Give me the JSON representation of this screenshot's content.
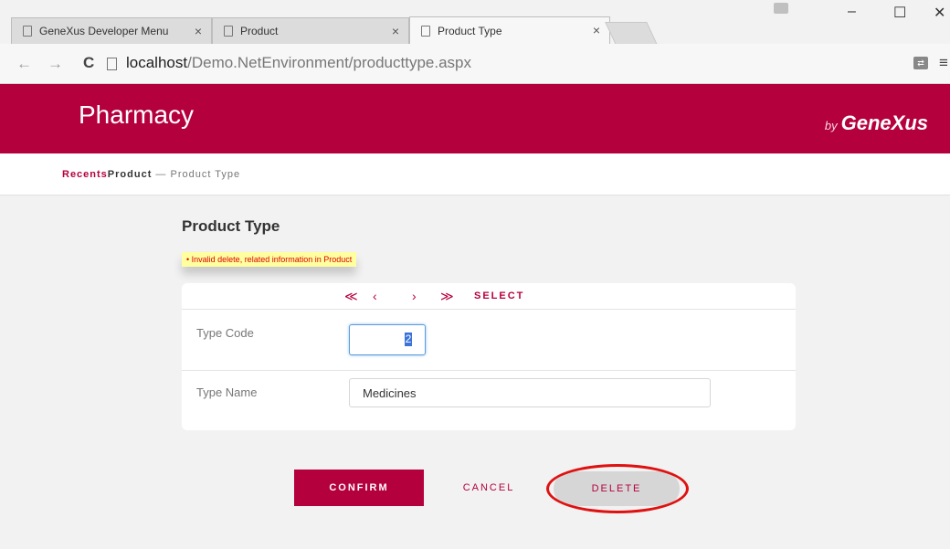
{
  "browser": {
    "tabs": [
      {
        "label": "GeneXus Developer Menu",
        "close": "×"
      },
      {
        "label": "Product",
        "close": "×"
      },
      {
        "label": "Product Type",
        "close": "×"
      }
    ],
    "window_controls": {
      "minimize": "–",
      "maximize": "☐",
      "close": "✕"
    },
    "nav": {
      "back": "←",
      "forward": "→",
      "reload": "C"
    },
    "url_host": "localhost",
    "url_path": "/Demo.NetEnvironment/producttype.aspx",
    "menu_icon": "≡"
  },
  "app": {
    "title": "Pharmacy",
    "by": "by",
    "brand": "GeneXus"
  },
  "breadcrumb": {
    "recents": "Recents",
    "parent": "Product",
    "separator": " — ",
    "current": "Product Type"
  },
  "page": {
    "title": "Product Type",
    "error": "• Invalid delete, related information in Product"
  },
  "navigation": {
    "first": "≪",
    "prev": "‹",
    "next": "›",
    "last": "≫",
    "select": "SELECT"
  },
  "form": {
    "type_code_label": "Type Code",
    "type_code_value": "2",
    "type_name_label": "Type Name",
    "type_name_value": "Medicines"
  },
  "actions": {
    "confirm": "CONFIRM",
    "cancel": "CANCEL",
    "delete": "DELETE"
  },
  "colors": {
    "brand": "#b5003e",
    "highlight": "#e01010"
  }
}
